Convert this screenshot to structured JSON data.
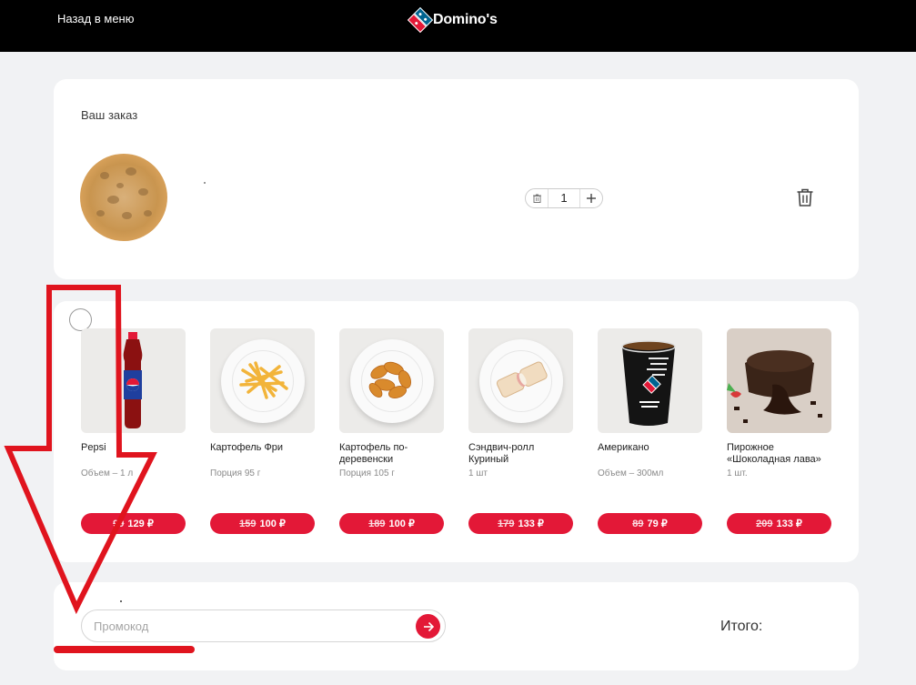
{
  "header": {
    "back_label": "Назад в меню",
    "logo_text": "Domino's",
    "brand_colors": {
      "red": "#e31837",
      "blue": "#006491"
    }
  },
  "order": {
    "title": "Ваш заказ",
    "item": {
      "quantity": "1"
    }
  },
  "upsell": {
    "products": [
      {
        "name": "Pepsi",
        "desc": "Объем – 1 л",
        "old_price": "99",
        "price": "129 ₽"
      },
      {
        "name": "Картофель Фри",
        "desc": "Порция 95 г",
        "old_price": "159",
        "price": "100 ₽"
      },
      {
        "name": "Картофель по-деревенски",
        "desc": "Порция 105 г",
        "old_price": "189",
        "price": "100 ₽"
      },
      {
        "name": "Сэндвич-ролл Куриный",
        "desc": "1 шт",
        "old_price": "179",
        "price": "133 ₽"
      },
      {
        "name": "Американо",
        "desc": "Объем – 300мл",
        "old_price": "89",
        "price": "79 ₽"
      },
      {
        "name": "Пирожное «Шоколадная лава»",
        "desc": "1 шт.",
        "old_price": "209",
        "price": "133 ₽"
      }
    ]
  },
  "promo": {
    "placeholder": "Промокод",
    "total_label": "Итого:"
  },
  "annotation": {
    "color": "#e0141e"
  }
}
